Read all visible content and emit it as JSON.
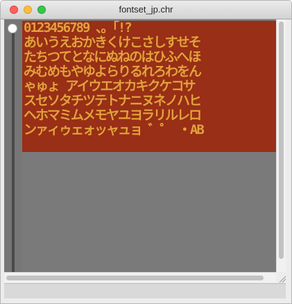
{
  "window": {
    "title": "fontset_jp.chr",
    "controls": [
      "close",
      "minimize",
      "zoom"
    ]
  },
  "tile_rows": [
    " 0123456789 、。「!?",
    "あいうえおかきくけこさしすせそ",
    "たちつてとなにぬねのはひふへほ",
    "みむめもやゆよらりるれろわをん",
    "ゃゅょ アイウエオカキクケコサ",
    "スセソタチツテトナニヌネノハヒ",
    "ヘホマミムメモヤユヨラリルレロ",
    "ンァィゥェォッャュョ ゛゜ ・AB"
  ],
  "colors": {
    "tile_background": "#982f16",
    "tile_glyph": "#e2a23c",
    "canvas_background": "#7a7a7a"
  },
  "icons": {
    "close": "close-icon",
    "minimize": "minimize-icon",
    "zoom": "zoom-icon",
    "handle": "circle-handle-icon",
    "grip": "resize-grip-icon"
  }
}
